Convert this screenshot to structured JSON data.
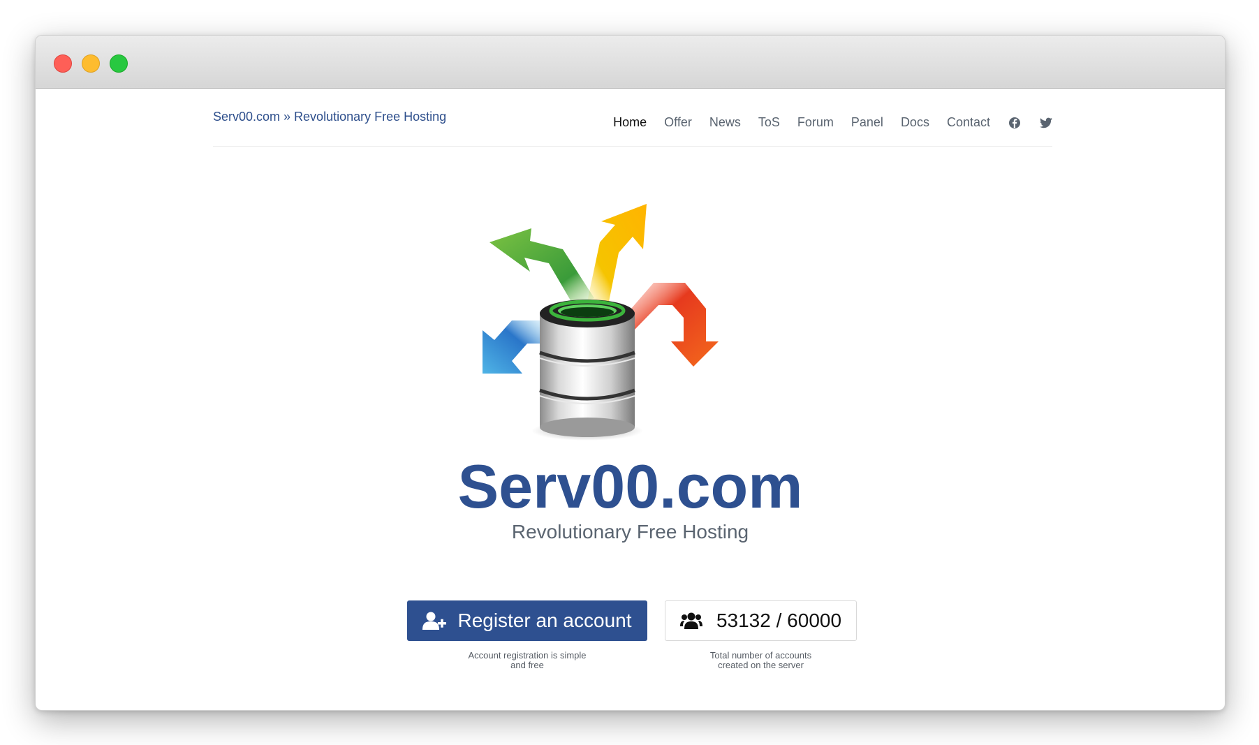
{
  "header": {
    "brand": "Serv00.com » Revolutionary Free Hosting",
    "nav": [
      "Home",
      "Offer",
      "News",
      "ToS",
      "Forum",
      "Panel",
      "Docs",
      "Contact"
    ],
    "social": [
      "facebook-icon",
      "twitter-icon"
    ]
  },
  "hero": {
    "title": "Serv00.com",
    "subtitle": "Revolutionary Free Hosting"
  },
  "actions": {
    "register_label": "Register an account",
    "register_icon": "user-plus-icon",
    "register_caption_line1": "Account registration is simple",
    "register_caption_line2": "and free",
    "counter_icon": "users-icon",
    "counter_text": "53132 / 60000",
    "counter_caption_line1": "Total number of accounts",
    "counter_caption_line2": "created on the server"
  },
  "colors": {
    "brand_blue": "#2e5090",
    "nav_text": "#5a6470"
  }
}
